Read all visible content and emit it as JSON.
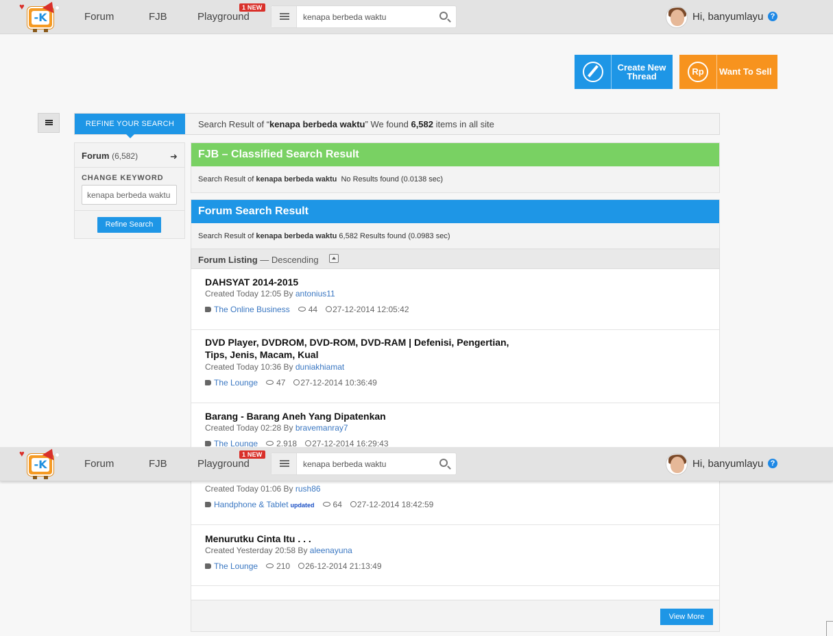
{
  "header": {
    "nav": [
      "Forum",
      "FJB",
      "Playground"
    ],
    "new_badge": "1 NEW",
    "search_value": "kenapa berbeda waktu",
    "greeting": "Hi, banyumlayu",
    "help": "?"
  },
  "actions": {
    "create_thread": "Create New Thread",
    "want_to_sell": "Want To Sell",
    "sell_icon_text": "Rp"
  },
  "search_header": {
    "refine_tab": "REFINE YOUR SEARCH",
    "prefix": "Search Result of “",
    "keyword": "kenapa berbeda waktu",
    "middle": "” We found ",
    "count": "6,582",
    "suffix": " items in all site"
  },
  "sidebar": {
    "forum_label": "Forum",
    "forum_count": "(6,582)",
    "change_keyword": "CHANGE KEYWORD",
    "keyword_value": "kenapa berbeda waktu",
    "refine_button": "Refine Search"
  },
  "fjb": {
    "title": "FJB – Classified Search Result",
    "sub_prefix": "Search Result of ",
    "keyword": "kenapa berbeda waktu",
    "sub_suffix": "  No Results found (0.0138 sec)"
  },
  "forum": {
    "title": "Forum Search Result",
    "sub_prefix": "Search Result of ",
    "keyword": "kenapa berbeda waktu",
    "sub_suffix": " 6,582 Results found (0.0983 sec)"
  },
  "listing": {
    "label": "Forum Listing",
    "order": " — Descending"
  },
  "threads": [
    {
      "title": "DAHSYAT 2014-2015",
      "created": "Created Today 12:05 By ",
      "author": "antonius11",
      "category": "The Online Business",
      "updated": "",
      "views": "44",
      "date": "27-12-2014 12:05:42"
    },
    {
      "title": "DVD Player, DVDROM, DVD-ROM, DVD-RAM | Defenisi, Pengertian, Tips, Jenis, Macam, Kual",
      "created": "Created Today 10:36 By ",
      "author": "duniakhiamat",
      "category": "The Lounge",
      "updated": "",
      "views": "47",
      "date": "27-12-2014 10:36:49"
    },
    {
      "title": "Barang - Barang Aneh Yang Dipatenkan",
      "created": "Created Today 02:28 By ",
      "author": "bravemanray7",
      "category": "The Lounge",
      "updated": "",
      "views": "2.918",
      "date": "27-12-2014 16:29:43"
    },
    {
      "title": "",
      "created": "Created Today 01:06 By ",
      "author": "rush86",
      "category": "Handphone & Tablet",
      "updated": "updated",
      "views": "64",
      "date": "27-12-2014 18:42:59"
    },
    {
      "title": "Menurutku Cinta Itu . . .",
      "created": "Created Yesterday 20:58 By ",
      "author": "aleenayuna",
      "category": "The Lounge",
      "updated": "",
      "views": "210",
      "date": "26-12-2014 21:13:49"
    }
  ],
  "view_more": "View More",
  "colors": {
    "blue": "#1e96e6",
    "green": "#79d163",
    "orange": "#f7931e",
    "badge_red": "#d9302a"
  }
}
